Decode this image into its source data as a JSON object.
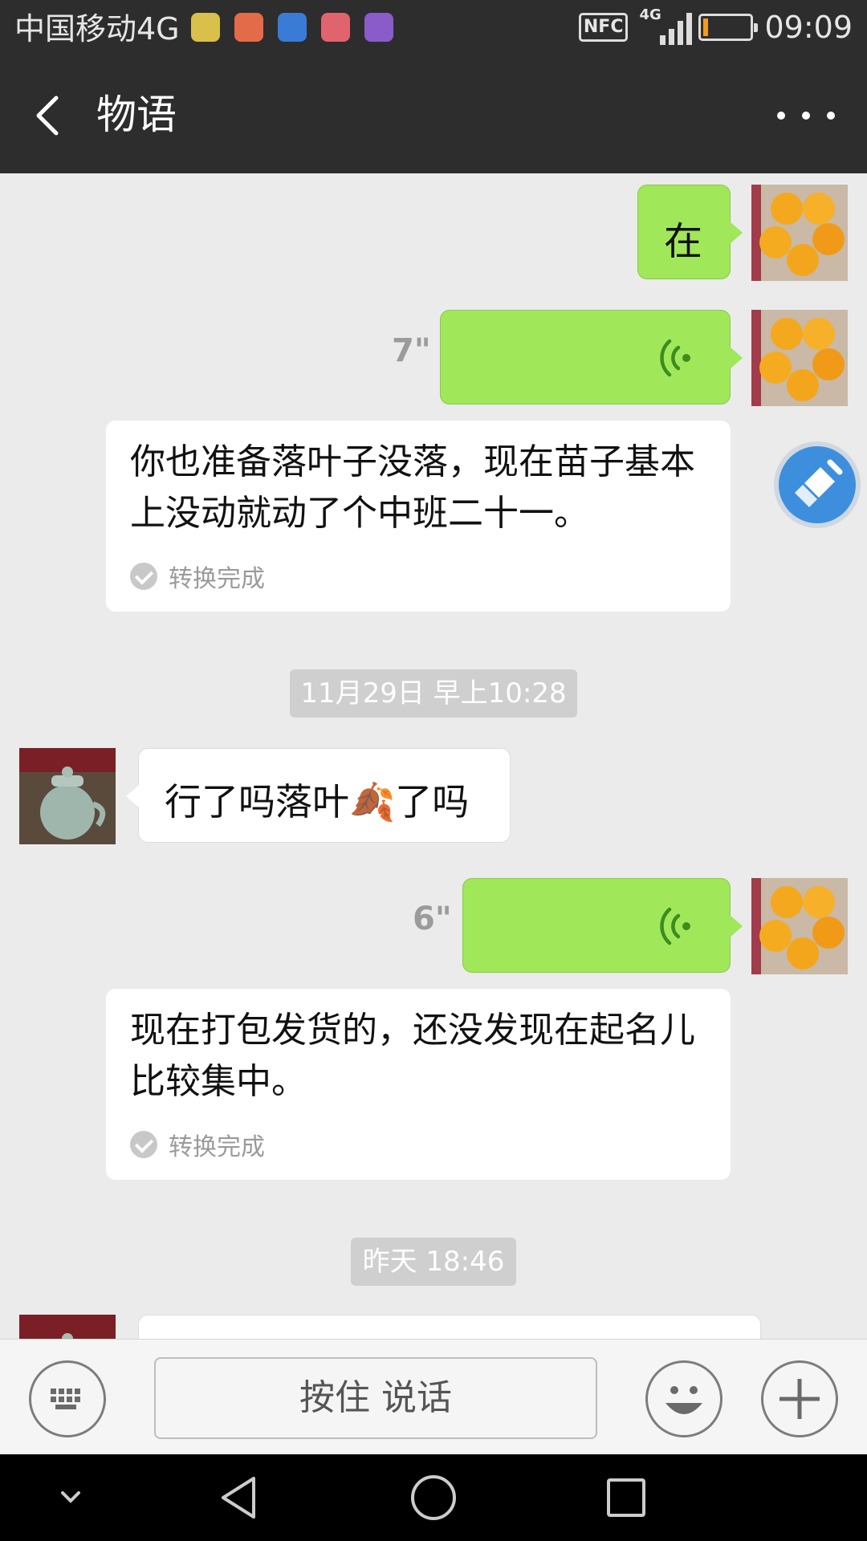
{
  "status_bar": {
    "carrier": "中国移动4G",
    "nfc_label": "NFC",
    "network_label": "4G",
    "time": "09:09",
    "battery_color": "#f39a1f"
  },
  "header": {
    "title": "物语",
    "back_icon": "chevron-left-icon",
    "more_icon": "more-dots-icon"
  },
  "messages": [
    {
      "side": "right",
      "type": "text",
      "text": "在"
    },
    {
      "side": "right",
      "type": "voice",
      "duration": "7\""
    },
    {
      "type": "voice-to-text",
      "text": "你也准备落叶子没落，现在苗子基本上没动就动了个中班二十一。",
      "status": "转换完成"
    },
    {
      "type": "timestamp",
      "text": "11月29日 早上10:28"
    },
    {
      "side": "left",
      "type": "text",
      "text_before": "行了吗落叶",
      "emoji": "🍂",
      "text_after": "了吗"
    },
    {
      "side": "right",
      "type": "voice",
      "duration": "6\""
    },
    {
      "type": "voice-to-text",
      "text": "现在打包发货的，还没发现在起名儿比较集中。",
      "status": "转换完成"
    },
    {
      "type": "timestamp",
      "text": "昨天 18:46"
    }
  ],
  "input_bar": {
    "hold_to_talk": "按住 说话",
    "keyboard_icon": "keyboard-icon",
    "emoji_icon": "smiley-icon",
    "plus_icon": "plus-icon"
  },
  "colors": {
    "header_bg": "#2d2d2d",
    "chat_bg": "#ebebeb",
    "sent_bubble": "#a0e75a",
    "received_bubble": "#ffffff",
    "voice_wave": "#3d8c1e",
    "float_button": "#3d8fde"
  }
}
